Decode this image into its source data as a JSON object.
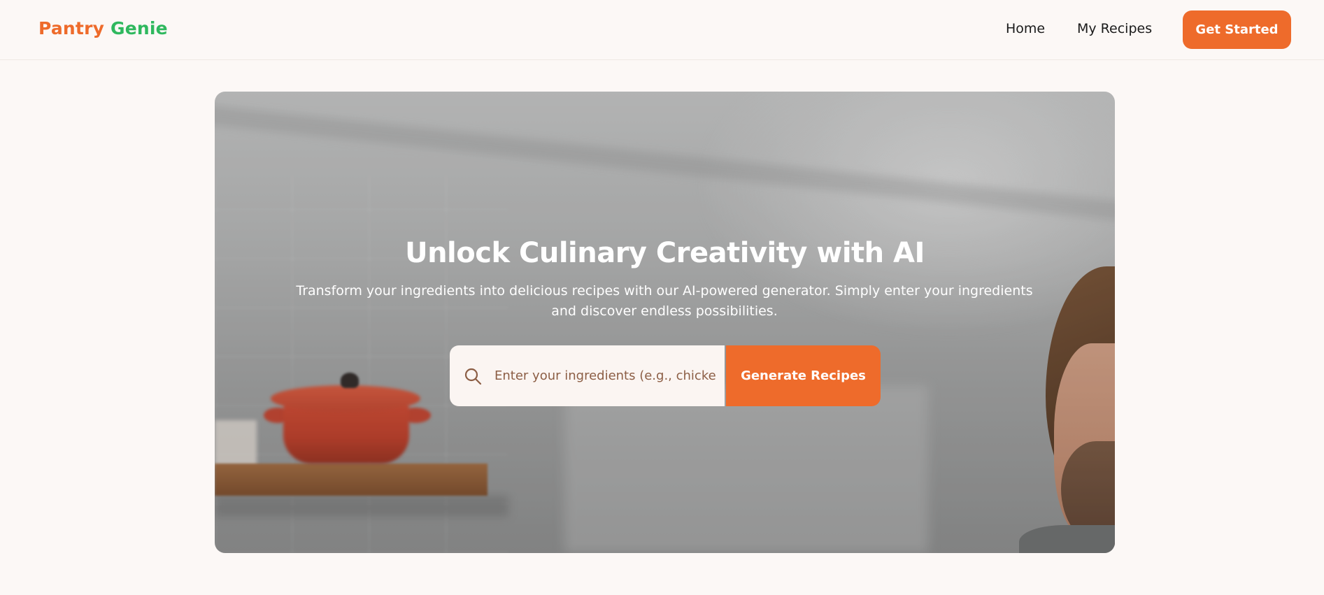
{
  "header": {
    "logo": {
      "word1": "Pantry",
      "word2": "Genie"
    },
    "nav": [
      {
        "label": "Home"
      },
      {
        "label": "My Recipes"
      }
    ],
    "cta_label": "Get Started"
  },
  "hero": {
    "title": "Unlock Culinary Creativity with AI",
    "subtitle": "Transform your ingredients into delicious recipes with our AI-powered generator. Simply enter your ingredients and discover endless possibilities.",
    "search": {
      "placeholder": "Enter your ingredients (e.g., chicken, tomatoes, basil)",
      "value": "",
      "icon": "search-icon"
    },
    "generate_label": "Generate Recipes"
  },
  "colors": {
    "accent": "#ee6b2b",
    "brand_green": "#2fb85e",
    "page_background": "#fcf8f6"
  }
}
